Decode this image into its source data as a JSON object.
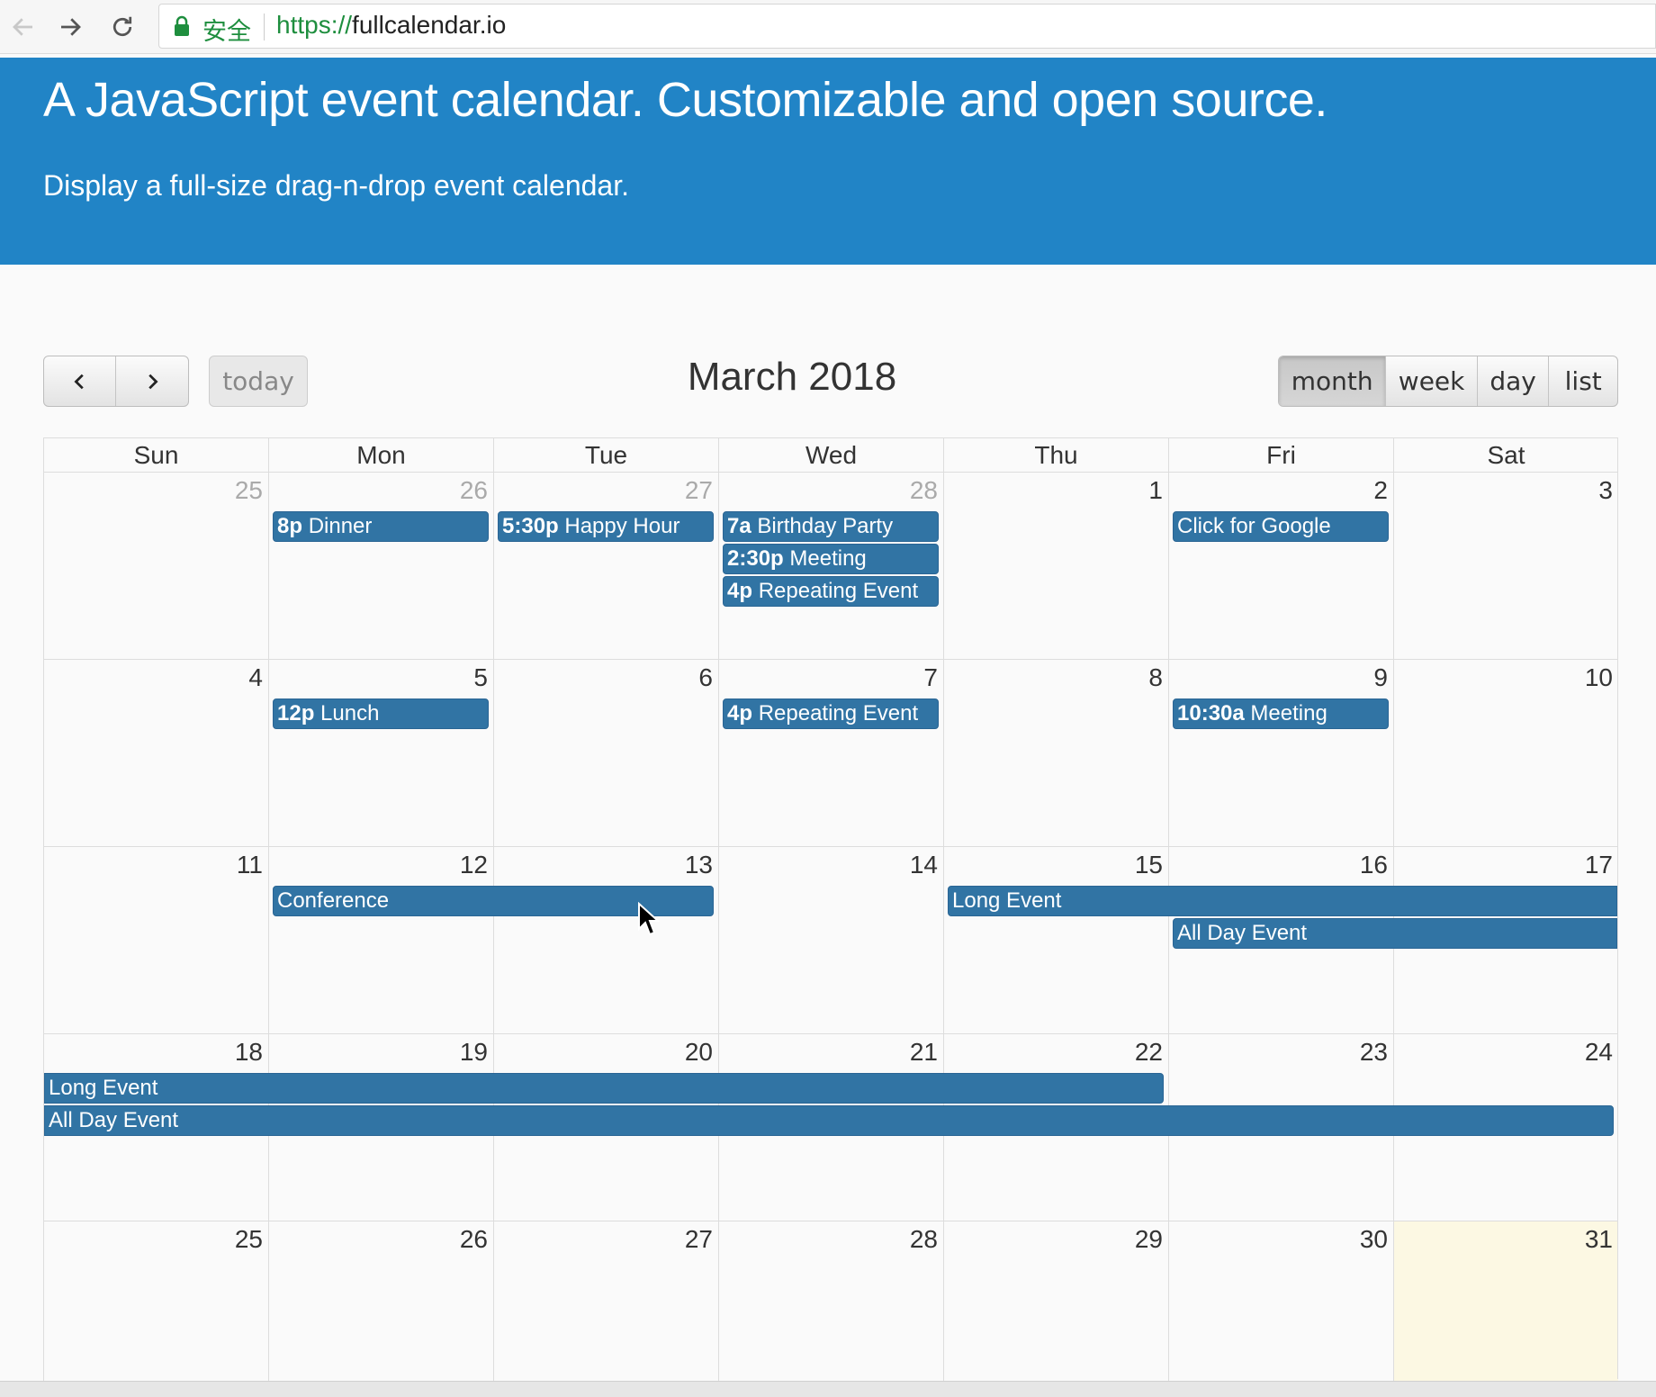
{
  "browser": {
    "secure_label": "安全",
    "url_scheme": "https://",
    "url_host": "fullcalendar.io"
  },
  "hero": {
    "title": "A JavaScript event calendar. Customizable and open source.",
    "subtitle": "Display a full-size drag-n-drop event calendar."
  },
  "toolbar": {
    "today_label": "today",
    "title": "March 2018",
    "views": [
      "month",
      "week",
      "day",
      "list"
    ],
    "active_view": "month"
  },
  "calendar": {
    "weekdays": [
      "Sun",
      "Mon",
      "Tue",
      "Wed",
      "Thu",
      "Fri",
      "Sat"
    ],
    "weeks": [
      [
        {
          "d": "25",
          "other": true
        },
        {
          "d": "26",
          "other": true
        },
        {
          "d": "27",
          "other": true
        },
        {
          "d": "28",
          "other": true
        },
        {
          "d": "1"
        },
        {
          "d": "2"
        },
        {
          "d": "3"
        }
      ],
      [
        {
          "d": "4"
        },
        {
          "d": "5"
        },
        {
          "d": "6"
        },
        {
          "d": "7"
        },
        {
          "d": "8"
        },
        {
          "d": "9"
        },
        {
          "d": "10"
        }
      ],
      [
        {
          "d": "11"
        },
        {
          "d": "12"
        },
        {
          "d": "13"
        },
        {
          "d": "14"
        },
        {
          "d": "15"
        },
        {
          "d": "16"
        },
        {
          "d": "17"
        }
      ],
      [
        {
          "d": "18"
        },
        {
          "d": "19"
        },
        {
          "d": "20"
        },
        {
          "d": "21"
        },
        {
          "d": "22"
        },
        {
          "d": "23"
        },
        {
          "d": "24"
        }
      ],
      [
        {
          "d": "25"
        },
        {
          "d": "26"
        },
        {
          "d": "27"
        },
        {
          "d": "28"
        },
        {
          "d": "29"
        },
        {
          "d": "30"
        },
        {
          "d": "31",
          "today": true
        }
      ]
    ],
    "events": [
      {
        "week": 0,
        "start": 1,
        "end": 1,
        "slot": 0,
        "time": "8p",
        "title": "Dinner"
      },
      {
        "week": 0,
        "start": 2,
        "end": 2,
        "slot": 0,
        "time": "5:30p",
        "title": "Happy Hour"
      },
      {
        "week": 0,
        "start": 3,
        "end": 3,
        "slot": 0,
        "time": "7a",
        "title": "Birthday Party"
      },
      {
        "week": 0,
        "start": 3,
        "end": 3,
        "slot": 1,
        "time": "2:30p",
        "title": "Meeting"
      },
      {
        "week": 0,
        "start": 3,
        "end": 3,
        "slot": 2,
        "time": "4p",
        "title": "Repeating Event"
      },
      {
        "week": 0,
        "start": 5,
        "end": 5,
        "slot": 0,
        "time": "",
        "title": "Click for Google"
      },
      {
        "week": 1,
        "start": 1,
        "end": 1,
        "slot": 0,
        "time": "12p",
        "title": "Lunch"
      },
      {
        "week": 1,
        "start": 3,
        "end": 3,
        "slot": 0,
        "time": "4p",
        "title": "Repeating Event"
      },
      {
        "week": 1,
        "start": 5,
        "end": 5,
        "slot": 0,
        "time": "10:30a",
        "title": "Meeting"
      },
      {
        "week": 2,
        "start": 1,
        "end": 2,
        "slot": 0,
        "time": "",
        "title": "Conference"
      },
      {
        "week": 2,
        "start": 4,
        "end": 6,
        "slot": 0,
        "time": "",
        "title": "Long Event",
        "cont_right": true
      },
      {
        "week": 2,
        "start": 5,
        "end": 6,
        "slot": 1,
        "time": "",
        "title": "All Day Event",
        "cont_right": true
      },
      {
        "week": 3,
        "start": 0,
        "end": 4,
        "slot": 0,
        "time": "",
        "title": "Long Event",
        "cont_left": true
      },
      {
        "week": 3,
        "start": 0,
        "end": 6,
        "slot": 1,
        "time": "",
        "title": "All Day Event",
        "cont_left": true
      }
    ]
  },
  "colors": {
    "hero_bg": "#2184c6",
    "event_bg": "#3174a4",
    "today_bg": "#fcf8e3"
  },
  "icons": {
    "back": "arrow-left-icon",
    "forward": "arrow-right-icon",
    "reload": "reload-icon",
    "lock": "lock-icon",
    "prev": "chevron-left-icon",
    "next": "chevron-right-icon",
    "cursor": "mouse-pointer-icon"
  }
}
